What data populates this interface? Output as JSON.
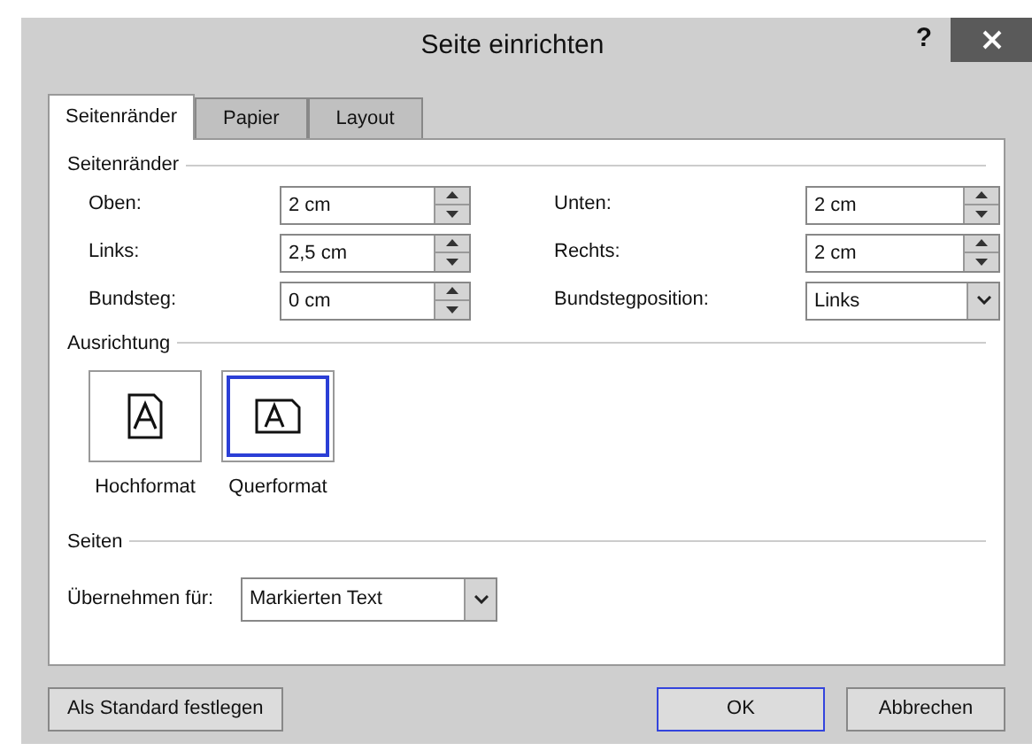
{
  "window": {
    "title": "Seite einrichten",
    "help": "?"
  },
  "tabs": [
    {
      "label": "Seitenränder",
      "selected": true
    },
    {
      "label": "Papier",
      "selected": false
    },
    {
      "label": "Layout",
      "selected": false
    }
  ],
  "margins": {
    "heading": "Seitenränder",
    "fields": [
      {
        "label": "Oben:",
        "value": "2 cm",
        "kind": "spin"
      },
      {
        "label": "Unten:",
        "value": "2 cm",
        "kind": "spin"
      },
      {
        "label": "Links:",
        "value": "2,5 cm",
        "kind": "spin"
      },
      {
        "label": "Rechts:",
        "value": "2 cm",
        "kind": "spin"
      },
      {
        "label": "Bundsteg:",
        "value": "0 cm",
        "kind": "spin"
      },
      {
        "label": "Bundstegposition:",
        "value": "Links",
        "kind": "select"
      }
    ]
  },
  "orientation": {
    "heading": "Ausrichtung",
    "options": [
      {
        "label": "Hochformat",
        "selected": false,
        "kind": "portrait"
      },
      {
        "label": "Querformat",
        "selected": true,
        "kind": "landscape"
      }
    ]
  },
  "pages": {
    "heading": "Seiten",
    "apply_label": "Übernehmen für:",
    "apply_value": "Markierten Text"
  },
  "buttons": {
    "default": "Als Standard festlegen",
    "ok": "OK",
    "cancel": "Abbrechen"
  }
}
